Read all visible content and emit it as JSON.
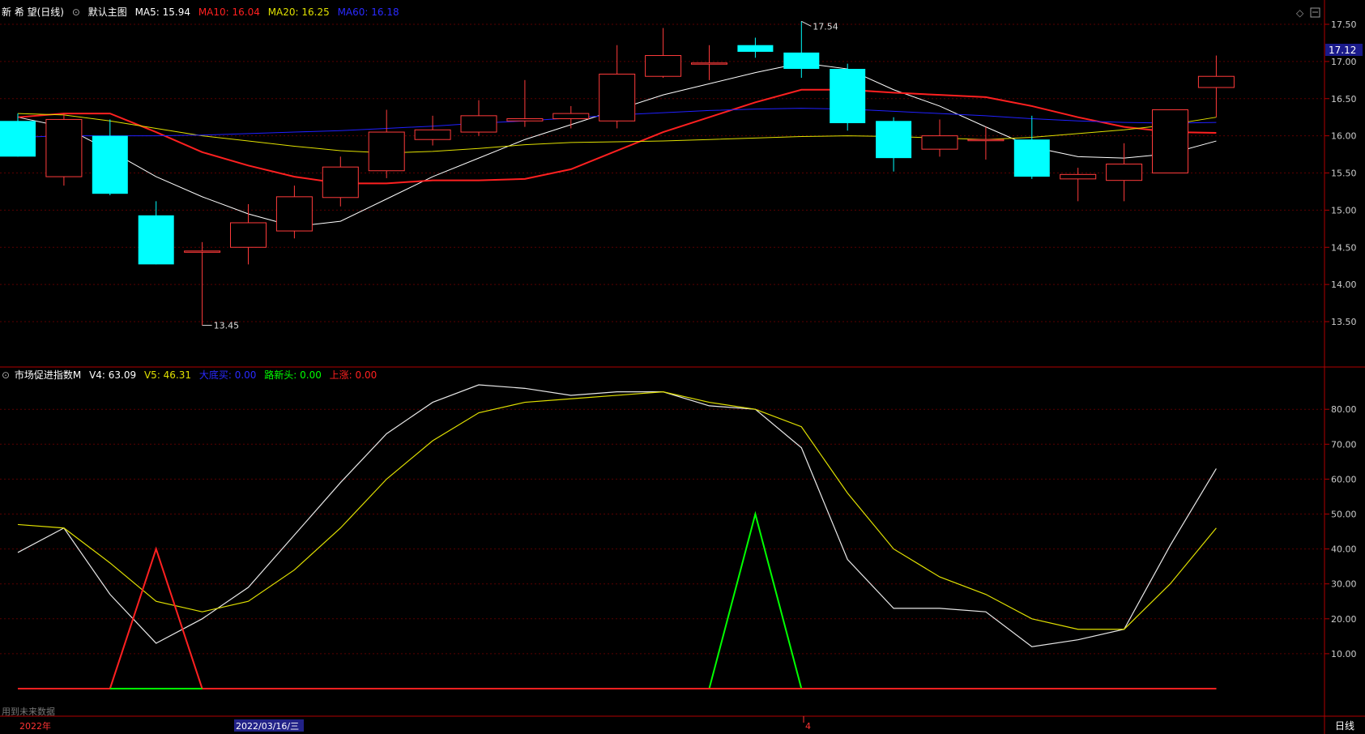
{
  "main_header": {
    "stock": "新 希 望(日线)",
    "chart_name": "默认主图",
    "ma5": "MA5: 15.94",
    "ma10": "MA10: 16.04",
    "ma20": "MA20: 16.25",
    "ma60": "MA60: 16.18"
  },
  "sub_header": {
    "indicator": "市场促进指数M",
    "v4": "V4: 63.09",
    "v5": "V5: 46.31",
    "s1": "大底买: 0.00",
    "s2": "路新头: 0.00",
    "s3": "上涨: 0.00"
  },
  "current_price": "17.12",
  "high_label": "17.54",
  "low_label": "13.45",
  "footer": {
    "future_note": "用到未来数据",
    "year_label": "2022年",
    "date_label": "2022/03/16/三",
    "month_label": "4",
    "period_button": "日线"
  },
  "colors": {
    "up": "#ff3b3b",
    "down": "#00ffff",
    "ma5": "#ffffff",
    "ma10": "#ff2020",
    "ma20": "#e0e000",
    "ma60": "#2020ff",
    "axis": "#b00000"
  },
  "chart_data": [
    {
      "type": "candlestick",
      "title": "新 希 望(日线)",
      "y_ticks": [
        13.5,
        14.0,
        14.5,
        15.0,
        15.5,
        16.0,
        16.5,
        17.0,
        17.5
      ],
      "ylim": [
        13.3,
        17.7
      ],
      "candles": [
        {
          "o": 16.2,
          "c": 15.72,
          "h": 16.3,
          "l": 15.72
        },
        {
          "o": 15.45,
          "c": 16.22,
          "h": 16.3,
          "l": 15.33
        },
        {
          "o": 16.0,
          "c": 15.22,
          "h": 16.22,
          "l": 15.2
        },
        {
          "o": 14.93,
          "c": 14.27,
          "h": 15.12,
          "l": 14.27
        },
        {
          "o": 14.45,
          "c": 14.45,
          "h": 14.57,
          "l": 13.45
        },
        {
          "o": 14.5,
          "c": 14.83,
          "h": 15.08,
          "l": 14.27
        },
        {
          "o": 14.72,
          "c": 15.18,
          "h": 15.33,
          "l": 14.62
        },
        {
          "o": 15.17,
          "c": 15.58,
          "h": 15.72,
          "l": 15.05
        },
        {
          "o": 15.53,
          "c": 16.05,
          "h": 16.35,
          "l": 15.43
        },
        {
          "o": 15.95,
          "c": 16.08,
          "h": 16.27,
          "l": 15.87
        },
        {
          "o": 16.05,
          "c": 16.27,
          "h": 16.48,
          "l": 16.0
        },
        {
          "o": 16.2,
          "c": 16.23,
          "h": 16.75,
          "l": 16.12
        },
        {
          "o": 16.23,
          "c": 16.3,
          "h": 16.4,
          "l": 16.1
        },
        {
          "o": 16.2,
          "c": 16.83,
          "h": 17.22,
          "l": 16.1
        },
        {
          "o": 16.8,
          "c": 17.08,
          "h": 17.45,
          "l": 16.78
        },
        {
          "o": 16.98,
          "c": 16.98,
          "h": 17.22,
          "l": 16.75
        },
        {
          "o": 17.22,
          "c": 17.13,
          "h": 17.32,
          "l": 17.05
        },
        {
          "o": 17.12,
          "c": 16.9,
          "h": 17.54,
          "l": 16.78
        },
        {
          "o": 16.9,
          "c": 16.17,
          "h": 16.97,
          "l": 16.07
        },
        {
          "o": 16.2,
          "c": 15.7,
          "h": 16.25,
          "l": 15.52
        },
        {
          "o": 15.82,
          "c": 16.0,
          "h": 16.22,
          "l": 15.72
        },
        {
          "o": 15.95,
          "c": 15.95,
          "h": 16.12,
          "l": 15.68
        },
        {
          "o": 15.95,
          "c": 15.45,
          "h": 16.27,
          "l": 15.42
        },
        {
          "o": 15.42,
          "c": 15.48,
          "h": 15.57,
          "l": 15.12
        },
        {
          "o": 15.4,
          "c": 15.62,
          "h": 15.9,
          "l": 15.12
        },
        {
          "o": 15.5,
          "c": 16.35,
          "h": 16.35,
          "l": 15.5
        },
        {
          "o": 16.65,
          "c": 16.8,
          "h": 17.08,
          "l": 16.25
        }
      ],
      "ma": {
        "MA5": [
          16.25,
          16.12,
          15.8,
          15.45,
          15.18,
          14.95,
          14.78,
          14.85,
          15.15,
          15.45,
          15.7,
          15.95,
          16.15,
          16.35,
          16.55,
          16.7,
          16.85,
          16.98,
          16.9,
          16.62,
          16.4,
          16.12,
          15.85,
          15.72,
          15.7,
          15.76,
          15.93
        ],
        "MA10": [
          16.25,
          16.3,
          16.3,
          16.05,
          15.78,
          15.6,
          15.45,
          15.36,
          15.36,
          15.4,
          15.4,
          15.42,
          15.55,
          15.8,
          16.05,
          16.25,
          16.45,
          16.62,
          16.62,
          16.58,
          16.55,
          16.52,
          16.4,
          16.25,
          16.12,
          16.05,
          16.04
        ],
        "MA20": [
          16.3,
          16.28,
          16.2,
          16.1,
          16.0,
          15.93,
          15.86,
          15.8,
          15.77,
          15.79,
          15.83,
          15.88,
          15.91,
          15.92,
          15.93,
          15.95,
          15.97,
          15.99,
          16.0,
          15.99,
          15.97,
          15.95,
          15.98,
          16.03,
          16.08,
          16.15,
          16.25
        ],
        "MA60": [
          15.98,
          16.0,
          16.0,
          16.0,
          16.01,
          16.03,
          16.05,
          16.07,
          16.1,
          16.13,
          16.17,
          16.2,
          16.24,
          16.28,
          16.31,
          16.34,
          16.36,
          16.37,
          16.36,
          16.33,
          16.3,
          16.27,
          16.23,
          16.2,
          16.18,
          16.17,
          16.18
        ]
      }
    },
    {
      "type": "line",
      "title": "市场促进指数M",
      "y_ticks": [
        10,
        20,
        30,
        40,
        50,
        60,
        70,
        80
      ],
      "ylim": [
        0,
        90
      ],
      "series": [
        {
          "name": "V4",
          "values": [
            39,
            46,
            27,
            13,
            20,
            29,
            44,
            59,
            73,
            82,
            87,
            86,
            84,
            85,
            85,
            81,
            80,
            69,
            37,
            23,
            23,
            22,
            12,
            14,
            17,
            41,
            63
          ]
        },
        {
          "name": "V5",
          "values": [
            47,
            46,
            36,
            25,
            22,
            25,
            34,
            46,
            60,
            71,
            79,
            82,
            83,
            84,
            85,
            82,
            80,
            75,
            56,
            40,
            32,
            27,
            20,
            17,
            17,
            30,
            46
          ]
        },
        {
          "name": "大底买",
          "values": [
            0,
            0,
            0,
            40,
            0,
            0,
            0,
            0,
            0,
            0,
            0,
            0,
            0,
            0,
            0,
            0,
            50,
            0,
            0,
            0,
            0,
            0,
            0,
            0,
            0,
            0,
            0
          ]
        },
        {
          "name": "路新头",
          "values": [
            0,
            0,
            0,
            0,
            0,
            0,
            0,
            0,
            0,
            0,
            0,
            0,
            0,
            0,
            0,
            0,
            0,
            0,
            0,
            0,
            0,
            0,
            0,
            0,
            0,
            0,
            0
          ]
        },
        {
          "name": "上涨",
          "values": [
            0,
            0,
            0,
            0,
            0,
            0,
            0,
            0,
            0,
            0,
            0,
            0,
            0,
            0,
            0,
            0,
            0,
            0,
            0,
            0,
            0,
            0,
            0,
            0,
            0,
            0,
            0
          ]
        }
      ]
    }
  ]
}
